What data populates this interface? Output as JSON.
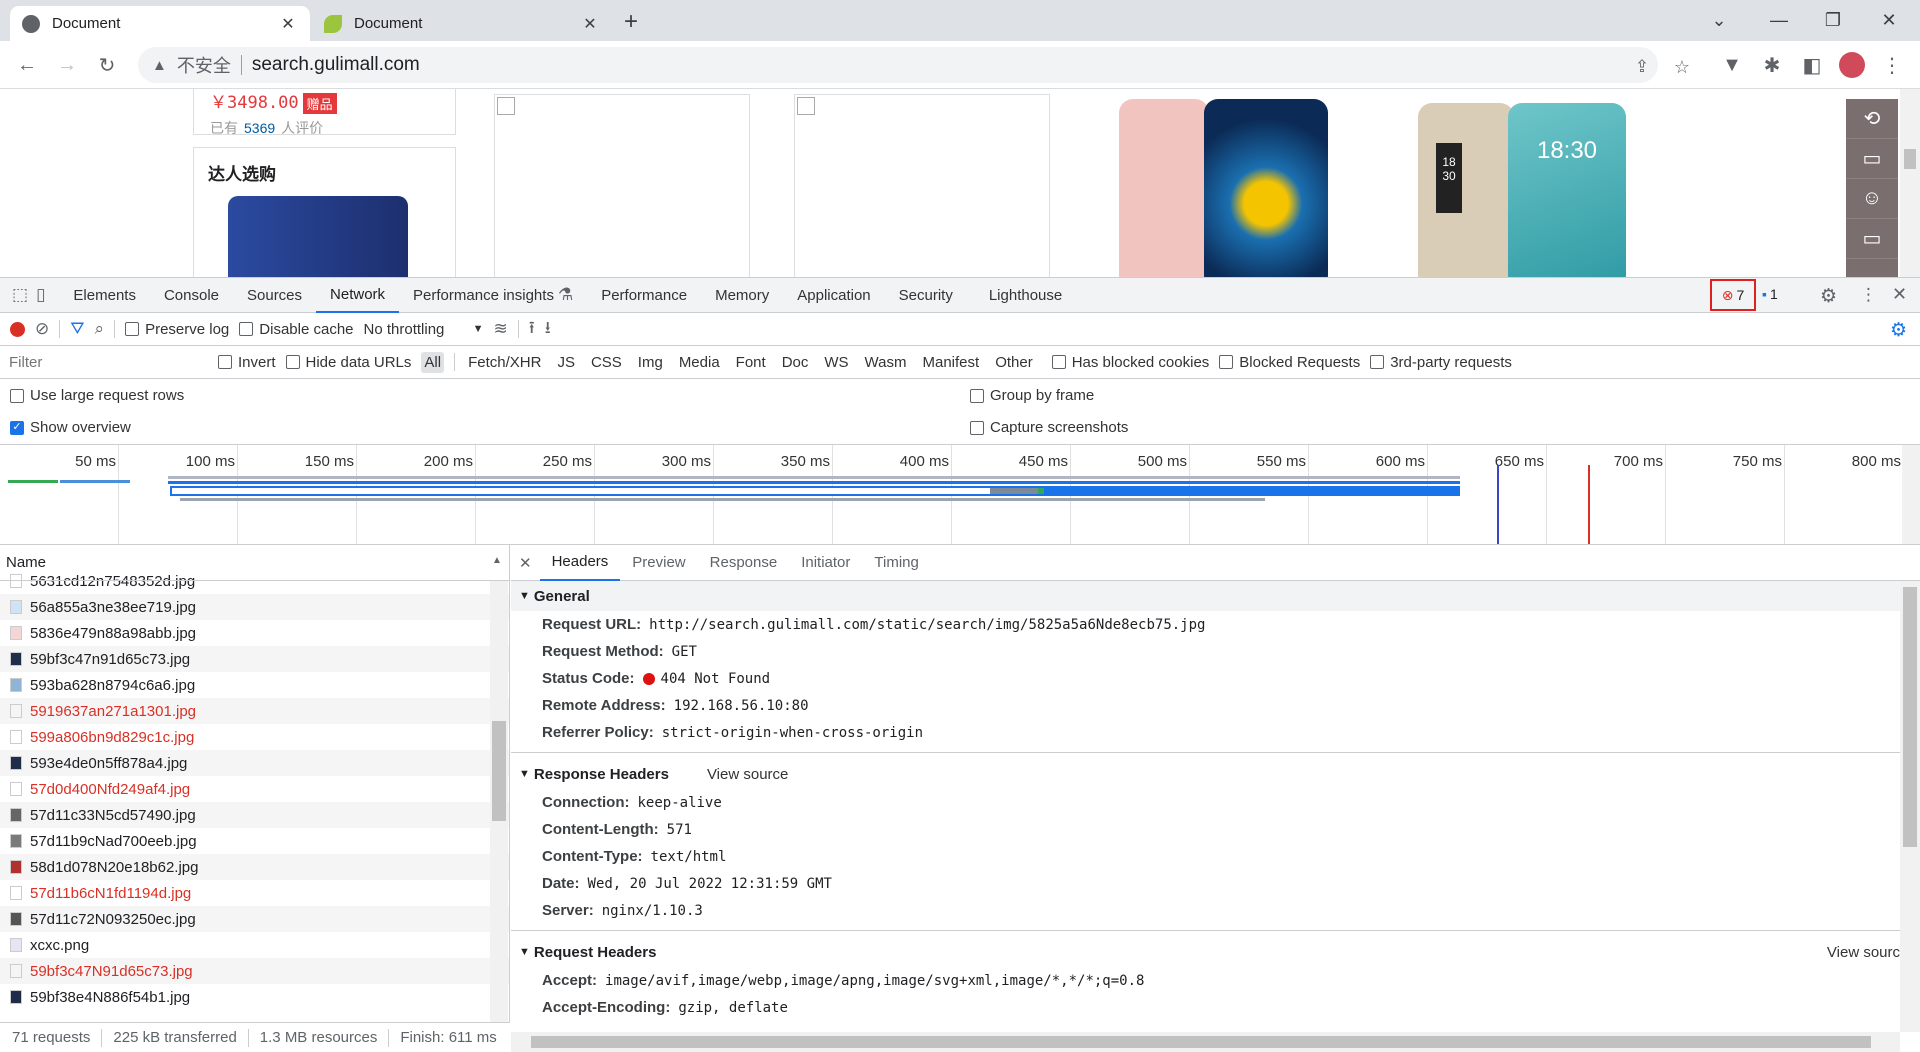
{
  "browser": {
    "tabs": [
      {
        "title": "Document",
        "active": true
      },
      {
        "title": "Document",
        "active": false
      }
    ],
    "new_tab": "+",
    "address": {
      "insecure_label": "不安全",
      "url": "search.gulimall.com"
    }
  },
  "page": {
    "product": {
      "price": "￥3498.00",
      "gift": "赠品",
      "review_prefix": "已有",
      "review_count": "5369",
      "review_suffix": "人评价"
    },
    "section_title": "达人选购",
    "phone_screen_time": "18:30",
    "phone_side_time": "18\n30"
  },
  "devtools": {
    "tabs": [
      "Elements",
      "Console",
      "Sources",
      "Network",
      "Performance insights",
      "Performance",
      "Memory",
      "Application",
      "Security",
      "Lighthouse"
    ],
    "selected_tab": "Network",
    "error_count": "7",
    "message_count": "1",
    "toolbar": {
      "preserve_log": "Preserve log",
      "disable_cache": "Disable cache",
      "throttling": "No throttling"
    },
    "filter": {
      "placeholder": "Filter",
      "invert": "Invert",
      "hide_data_urls": "Hide data URLs",
      "types": [
        "All",
        "Fetch/XHR",
        "JS",
        "CSS",
        "Img",
        "Media",
        "Font",
        "Doc",
        "WS",
        "Wasm",
        "Manifest",
        "Other"
      ],
      "selected_type": "All",
      "has_blocked_cookies": "Has blocked cookies",
      "blocked_requests": "Blocked Requests",
      "third_party": "3rd-party requests"
    },
    "options": {
      "large_rows": "Use large request rows",
      "show_overview": "Show overview",
      "group_by_frame": "Group by frame",
      "capture_screenshots": "Capture screenshots"
    },
    "timeline_ticks": [
      "50 ms",
      "100 ms",
      "150 ms",
      "200 ms",
      "250 ms",
      "300 ms",
      "350 ms",
      "400 ms",
      "450 ms",
      "500 ms",
      "550 ms",
      "600 ms",
      "650 ms",
      "700 ms",
      "750 ms",
      "800 ms"
    ],
    "name_header": "Name",
    "requests": [
      {
        "name": "5631cd12n7548352d.jpg",
        "error": false
      },
      {
        "name": "56a855a3ne38ee719.jpg",
        "error": false
      },
      {
        "name": "5836e479n88a98abb.jpg",
        "error": false
      },
      {
        "name": "59bf3c47n91d65c73.jpg",
        "error": false
      },
      {
        "name": "593ba628n8794c6a6.jpg",
        "error": false
      },
      {
        "name": "5919637an271a1301.jpg",
        "error": true
      },
      {
        "name": "599a806bn9d829c1c.jpg",
        "error": true
      },
      {
        "name": "593e4de0n5ff878a4.jpg",
        "error": false
      },
      {
        "name": "57d0d400Nfd249af4.jpg",
        "error": true
      },
      {
        "name": "57d11c33N5cd57490.jpg",
        "error": false
      },
      {
        "name": "57d11b9cNad700eeb.jpg",
        "error": false
      },
      {
        "name": "58d1d078N20e18b62.jpg",
        "error": false
      },
      {
        "name": "57d11b6cN1fd1194d.jpg",
        "error": true
      },
      {
        "name": "57d11c72N093250ec.jpg",
        "error": false
      },
      {
        "name": "xcxc.png",
        "error": false
      },
      {
        "name": "59bf3c47N91d65c73.jpg",
        "error": true
      },
      {
        "name": "59bf38e4N886f54b1.jpg",
        "error": false
      }
    ],
    "status": {
      "requests": "71 requests",
      "transferred": "225 kB transferred",
      "resources": "1.3 MB resources",
      "finish": "Finish: 611 ms"
    },
    "detail_tabs": [
      "Headers",
      "Preview",
      "Response",
      "Initiator",
      "Timing"
    ],
    "selected_detail_tab": "Headers",
    "general": {
      "title": "General",
      "request_url_k": "Request URL:",
      "request_url": "http://search.gulimall.com/static/search/img/5825a5a6Nde8ecb75.jpg",
      "method_k": "Request Method:",
      "method": "GET",
      "status_k": "Status Code:",
      "status": "404 Not Found",
      "remote_k": "Remote Address:",
      "remote": "192.168.56.10:80",
      "referrer_k": "Referrer Policy:",
      "referrer": "strict-origin-when-cross-origin"
    },
    "response_headers": {
      "title": "Response Headers",
      "view_source": "View source",
      "connection_k": "Connection:",
      "connection": "keep-alive",
      "length_k": "Content-Length:",
      "length": "571",
      "type_k": "Content-Type:",
      "type": "text/html",
      "date_k": "Date:",
      "date": "Wed, 20 Jul 2022 12:31:59 GMT",
      "server_k": "Server:",
      "server": "nginx/1.10.3"
    },
    "request_headers": {
      "title": "Request Headers",
      "view_source": "View sourc",
      "accept_k": "Accept:",
      "accept": "image/avif,image/webp,image/apng,image/svg+xml,image/*,*/*;q=0.8",
      "encoding_k": "Accept-Encoding:",
      "encoding": "gzip, deflate"
    }
  }
}
